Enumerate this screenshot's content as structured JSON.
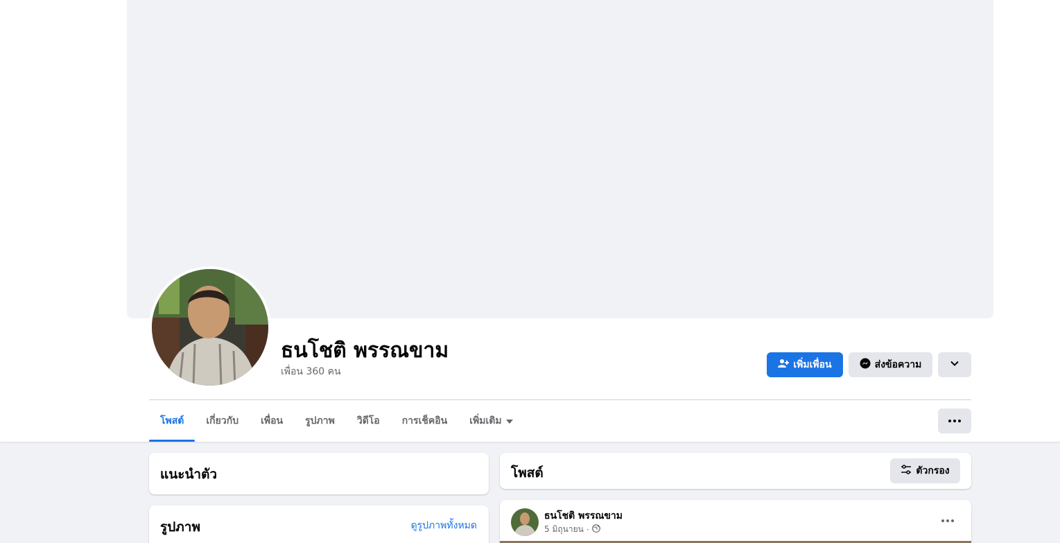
{
  "profile": {
    "name": "ธนโชติ พรรณขาม",
    "friends_text": "เพื่อน 360 คน"
  },
  "actions": {
    "add_friend": "เพิ่มเพื่อน",
    "message": "ส่งข้อความ"
  },
  "tabs": [
    {
      "label": "โพสต์",
      "active": true
    },
    {
      "label": "เกี่ยวกับ"
    },
    {
      "label": "เพื่อน"
    },
    {
      "label": "รูปภาพ"
    },
    {
      "label": "วิดีโอ"
    },
    {
      "label": "การเช็คอิน"
    },
    {
      "label": "เพิ่มเติม"
    }
  ],
  "intro": {
    "title": "แนะนำตัว"
  },
  "photos": {
    "title": "รูปภาพ",
    "see_all": "ดูรูปภาพทั้งหมด"
  },
  "posts_header": {
    "title": "โพสต์",
    "filter": "ตัวกรอง"
  },
  "post": {
    "author": "ธนโชติ พรรณขาม",
    "date": "5 มิถุนายน",
    "separator": "·"
  },
  "colors": {
    "accent": "#1b74e4",
    "secondary_button": "#e4e6eb",
    "page_background": "#f0f2f5",
    "muted_text": "#65676b"
  }
}
